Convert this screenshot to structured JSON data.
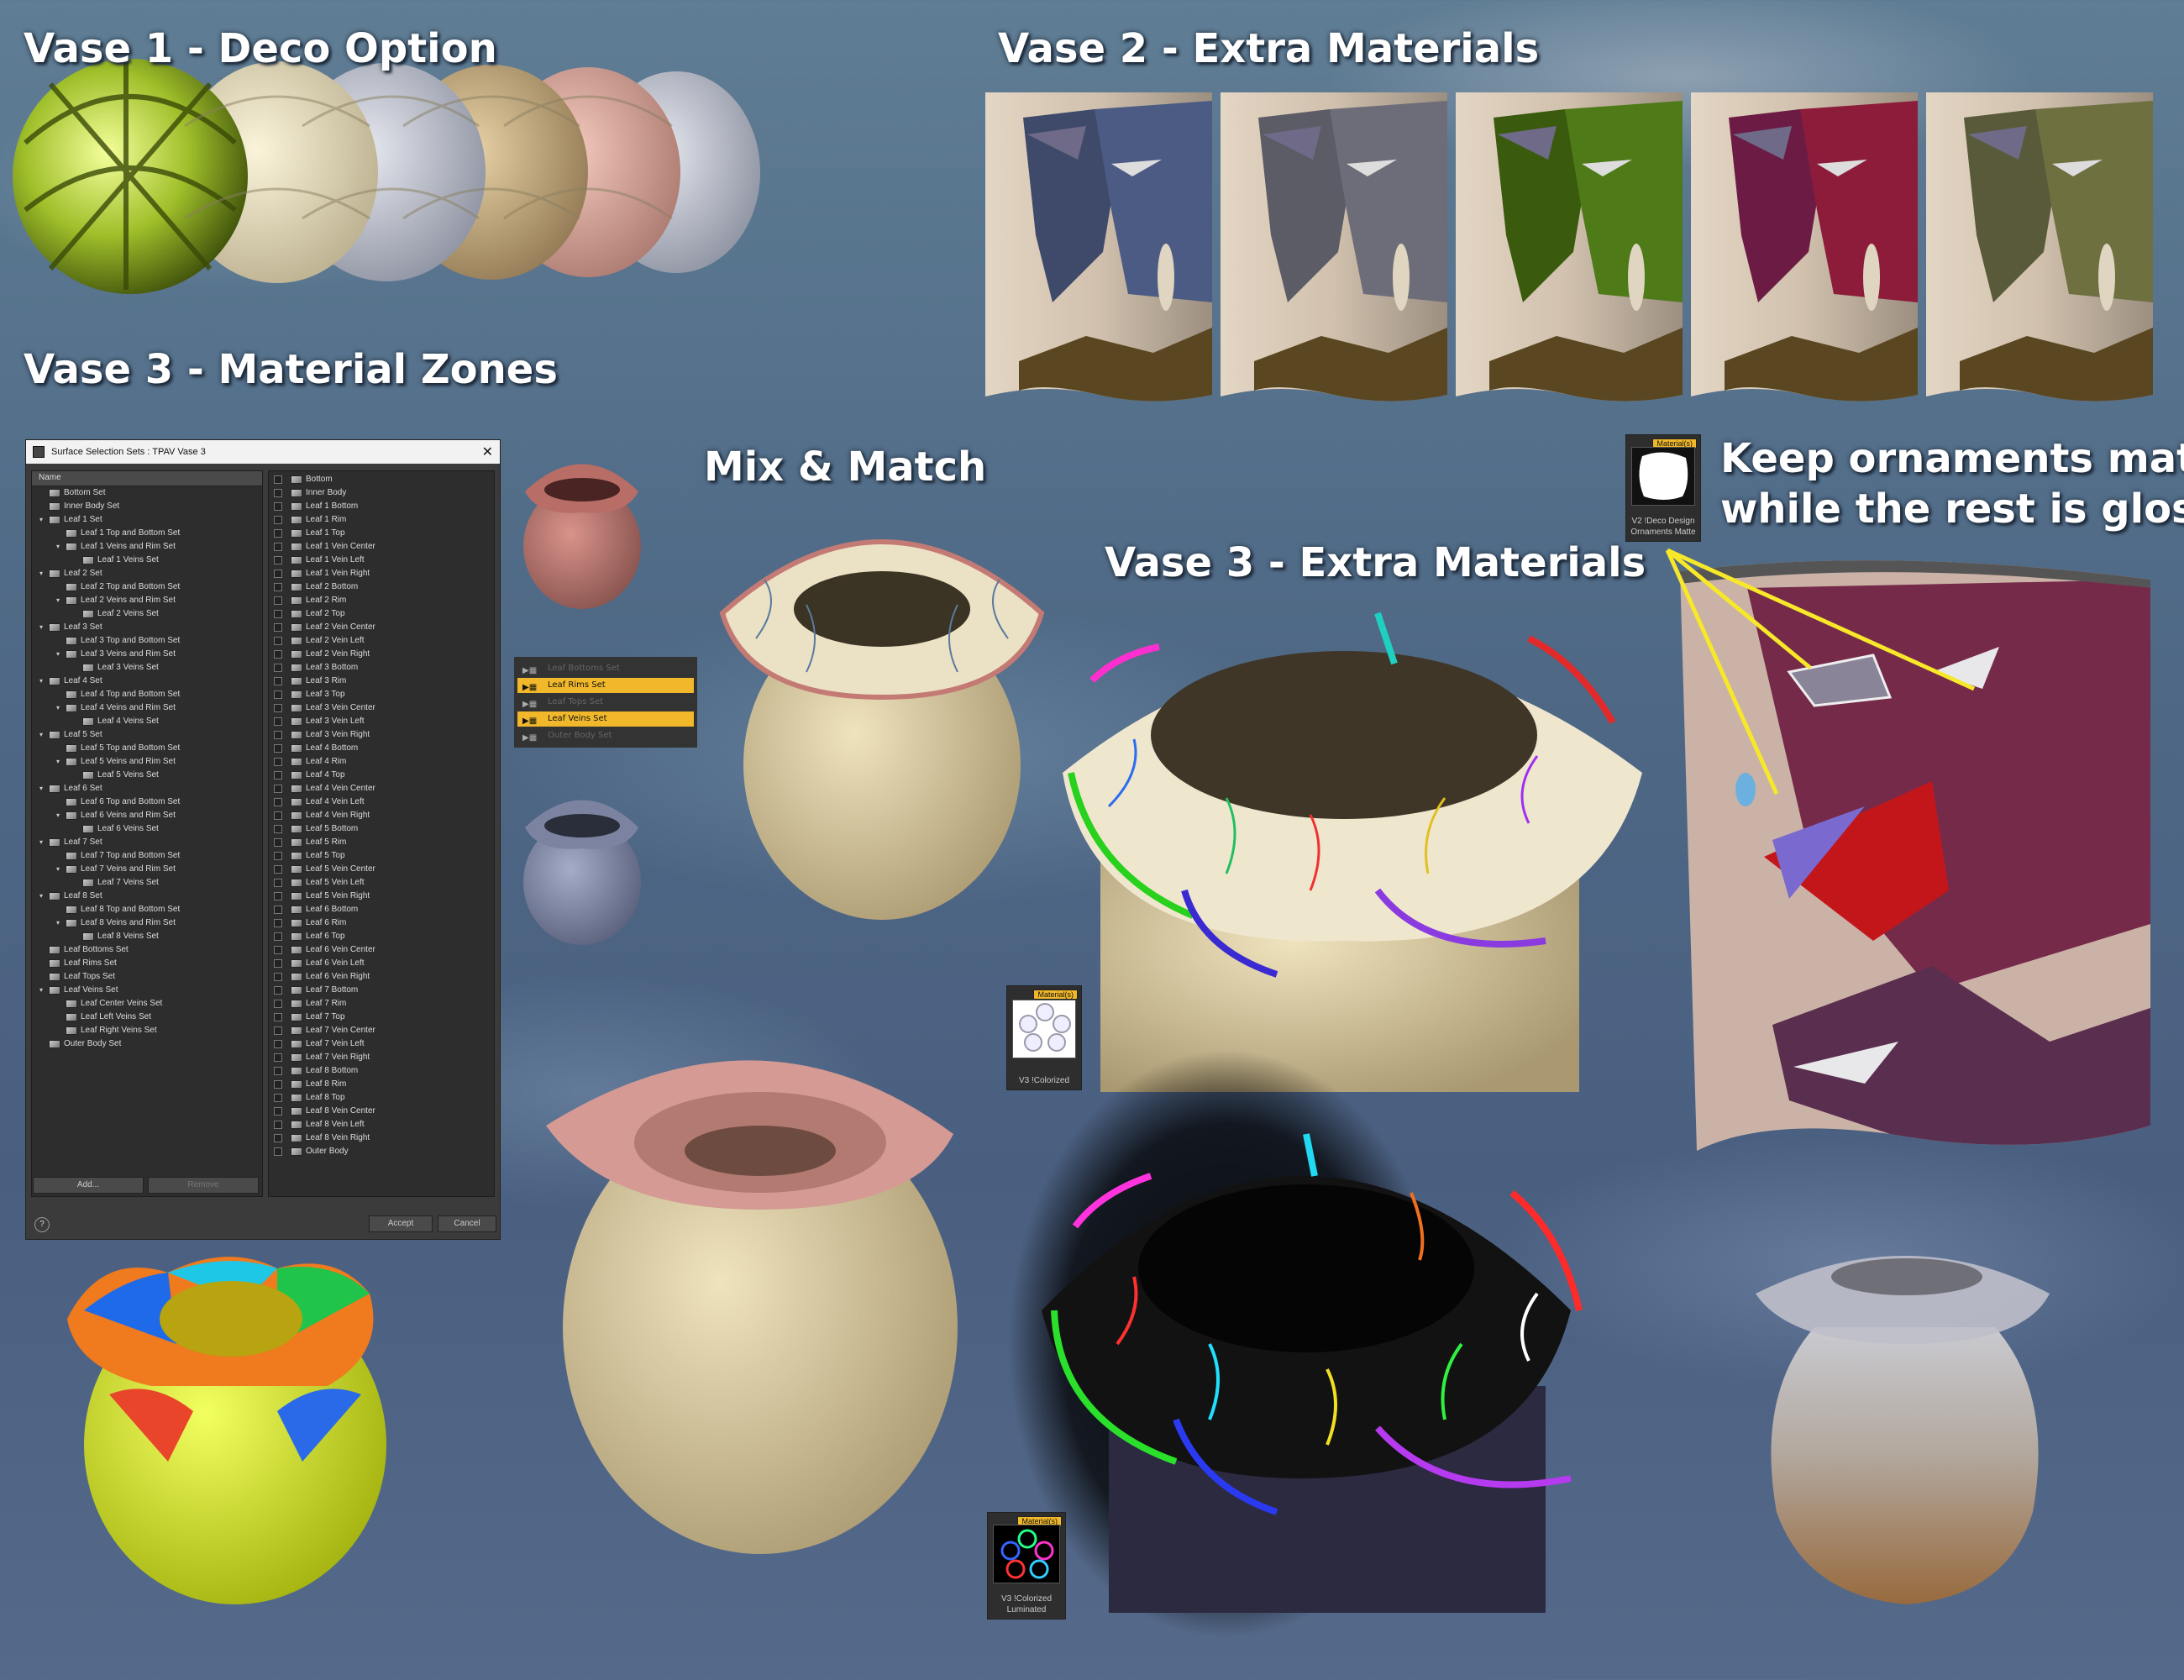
{
  "headings": {
    "vase1": "Vase 1 - Deco Option",
    "vase2": "Vase 2 - Extra Materials",
    "vase3_zones": "Vase 3 - Material Zones",
    "mix": "Mix & Match",
    "vase3_extra": "Vase 3 - Extra Materials",
    "ornaments_l1": "Keep ornaments matte",
    "ornaments_l2": "while the rest is glossy"
  },
  "dialog": {
    "title": "Surface Selection Sets : TPAV Vase 3",
    "column": "Name",
    "add": "Add...",
    "remove": "Remove",
    "accept": "Accept",
    "cancel": "Cancel",
    "help": "?",
    "left_items": [
      {
        "label": "Bottom Set",
        "depth": 0,
        "tw": ""
      },
      {
        "label": "Inner Body Set",
        "depth": 0,
        "tw": ""
      },
      {
        "label": "Leaf 1 Set",
        "depth": 0,
        "tw": "▾"
      },
      {
        "label": "Leaf 1 Top and Bottom Set",
        "depth": 1,
        "tw": ""
      },
      {
        "label": "Leaf 1 Veins and Rim Set",
        "depth": 1,
        "tw": "▾"
      },
      {
        "label": "Leaf 1 Veins Set",
        "depth": 2,
        "tw": ""
      },
      {
        "label": "Leaf 2 Set",
        "depth": 0,
        "tw": "▾"
      },
      {
        "label": "Leaf 2 Top and Bottom Set",
        "depth": 1,
        "tw": ""
      },
      {
        "label": "Leaf 2 Veins and Rim Set",
        "depth": 1,
        "tw": "▾"
      },
      {
        "label": "Leaf 2 Veins Set",
        "depth": 2,
        "tw": ""
      },
      {
        "label": "Leaf 3 Set",
        "depth": 0,
        "tw": "▾"
      },
      {
        "label": "Leaf 3 Top and Bottom Set",
        "depth": 1,
        "tw": ""
      },
      {
        "label": "Leaf 3 Veins and Rim Set",
        "depth": 1,
        "tw": "▾"
      },
      {
        "label": "Leaf 3 Veins Set",
        "depth": 2,
        "tw": ""
      },
      {
        "label": "Leaf 4 Set",
        "depth": 0,
        "tw": "▾"
      },
      {
        "label": "Leaf 4 Top and Bottom Set",
        "depth": 1,
        "tw": ""
      },
      {
        "label": "Leaf 4 Veins and Rim Set",
        "depth": 1,
        "tw": "▾"
      },
      {
        "label": "Leaf 4 Veins Set",
        "depth": 2,
        "tw": ""
      },
      {
        "label": "Leaf 5 Set",
        "depth": 0,
        "tw": "▾"
      },
      {
        "label": "Leaf 5 Top and Bottom Set",
        "depth": 1,
        "tw": ""
      },
      {
        "label": "Leaf 5 Veins and Rim Set",
        "depth": 1,
        "tw": "▾"
      },
      {
        "label": "Leaf 5 Veins Set",
        "depth": 2,
        "tw": ""
      },
      {
        "label": "Leaf 6 Set",
        "depth": 0,
        "tw": "▾"
      },
      {
        "label": "Leaf 6 Top and Bottom Set",
        "depth": 1,
        "tw": ""
      },
      {
        "label": "Leaf 6 Veins and Rim Set",
        "depth": 1,
        "tw": "▾"
      },
      {
        "label": "Leaf 6 Veins Set",
        "depth": 2,
        "tw": ""
      },
      {
        "label": "Leaf 7 Set",
        "depth": 0,
        "tw": "▾"
      },
      {
        "label": "Leaf 7 Top and Bottom Set",
        "depth": 1,
        "tw": ""
      },
      {
        "label": "Leaf 7 Veins and Rim Set",
        "depth": 1,
        "tw": "▾"
      },
      {
        "label": "Leaf 7 Veins Set",
        "depth": 2,
        "tw": ""
      },
      {
        "label": "Leaf 8 Set",
        "depth": 0,
        "tw": "▾"
      },
      {
        "label": "Leaf 8 Top and Bottom Set",
        "depth": 1,
        "tw": ""
      },
      {
        "label": "Leaf 8 Veins and Rim Set",
        "depth": 1,
        "tw": "▾"
      },
      {
        "label": "Leaf 8 Veins Set",
        "depth": 2,
        "tw": ""
      },
      {
        "label": "Leaf Bottoms Set",
        "depth": 0,
        "tw": ""
      },
      {
        "label": "Leaf Rims Set",
        "depth": 0,
        "tw": ""
      },
      {
        "label": "Leaf Tops Set",
        "depth": 0,
        "tw": ""
      },
      {
        "label": "Leaf Veins Set",
        "depth": 0,
        "tw": "▾"
      },
      {
        "label": "Leaf Center Veins Set",
        "depth": 1,
        "tw": ""
      },
      {
        "label": "Leaf Left Veins Set",
        "depth": 1,
        "tw": ""
      },
      {
        "label": "Leaf Right Veins Set",
        "depth": 1,
        "tw": ""
      },
      {
        "label": "Outer Body Set",
        "depth": 0,
        "tw": ""
      }
    ],
    "right_items": [
      "Bottom",
      "Inner Body",
      "Leaf 1 Bottom",
      "Leaf 1 Rim",
      "Leaf 1 Top",
      "Leaf 1 Vein Center",
      "Leaf 1 Vein Left",
      "Leaf 1 Vein Right",
      "Leaf 2 Bottom",
      "Leaf 2 Rim",
      "Leaf 2 Top",
      "Leaf 2 Vein Center",
      "Leaf 2 Vein Left",
      "Leaf 2 Vein Right",
      "Leaf 3 Bottom",
      "Leaf 3 Rim",
      "Leaf 3 Top",
      "Leaf 3 Vein Center",
      "Leaf 3 Vein Left",
      "Leaf 3 Vein Right",
      "Leaf 4 Bottom",
      "Leaf 4 Rim",
      "Leaf 4 Top",
      "Leaf 4 Vein Center",
      "Leaf 4 Vein Left",
      "Leaf 4 Vein Right",
      "Leaf 5 Bottom",
      "Leaf 5 Rim",
      "Leaf 5 Top",
      "Leaf 5 Vein Center",
      "Leaf 5 Vein Left",
      "Leaf 5 Vein Right",
      "Leaf 6 Bottom",
      "Leaf 6 Rim",
      "Leaf 6 Top",
      "Leaf 6 Vein Center",
      "Leaf 6 Vein Left",
      "Leaf 6 Vein Right",
      "Leaf 7 Bottom",
      "Leaf 7 Rim",
      "Leaf 7 Top",
      "Leaf 7 Vein Center",
      "Leaf 7 Vein Left",
      "Leaf 7 Vein Right",
      "Leaf 8 Bottom",
      "Leaf 8 Rim",
      "Leaf 8 Top",
      "Leaf 8 Vein Center",
      "Leaf 8 Vein Left",
      "Leaf 8 Vein Right",
      "Outer Body"
    ]
  },
  "pill_sets": [
    {
      "label": "Leaf Bottoms Set",
      "active": false
    },
    {
      "label": "Leaf Rims Set",
      "active": true
    },
    {
      "label": "Leaf Tops Set",
      "active": false
    },
    {
      "label": "Leaf Veins Set",
      "active": true
    },
    {
      "label": "Outer Body Set",
      "active": false
    }
  ],
  "thumbs": {
    "v2": {
      "badge": "Material(s)",
      "cap1": "V2 !Deco Design",
      "cap2": "Ornaments Matte"
    },
    "v3c": {
      "badge": "Material(s)",
      "cap1": "V3 !Colorized"
    },
    "v3cl": {
      "badge": "Material(s)",
      "cap1": "V3 !Colorized",
      "cap2": "Luminated"
    }
  },
  "colors": {
    "accent": "#f0b82a",
    "pointer": "#f7e829",
    "heading": "#ffffff"
  }
}
